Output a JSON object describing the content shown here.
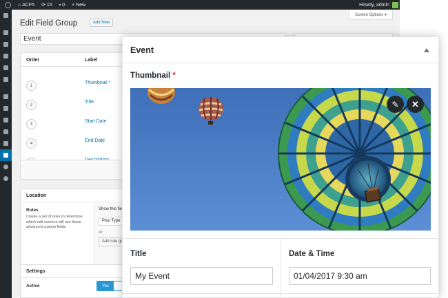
{
  "admin_bar": {
    "site_name": "ACF5",
    "updates_count": "15",
    "comments_count": "0",
    "new_label": "New",
    "greeting": "Howdy, admin"
  },
  "admin_menu": {
    "items": [
      "dashboard-icon",
      "pin-icon",
      "media-icon",
      "pages-icon",
      "comments-icon",
      "pin-icon",
      "appearance-icon",
      "plugins-icon",
      "users-icon",
      "tools-icon",
      "settings-icon",
      "custom-fields-icon",
      "gear-icon",
      "collapse-icon"
    ]
  },
  "edit_page": {
    "title": "Edit Field Group",
    "add_new_label": "Add New",
    "screen_options_label": "Screen Options ▾",
    "field_group_title": "Event"
  },
  "fields_table": {
    "headers": {
      "order": "Order",
      "label": "Label"
    },
    "rows": [
      {
        "order": "1",
        "label": "Thumbnail",
        "required": "*"
      },
      {
        "order": "2",
        "label": "Title"
      },
      {
        "order": "3",
        "label": "Start Date"
      },
      {
        "order": "4",
        "label": "End Date"
      },
      {
        "order": "5",
        "label": "Description"
      }
    ]
  },
  "location": {
    "heading": "Location",
    "rules_label": "Rules",
    "rules_description": "Create a set of rules to determine which edit screens will use these advanced custom fields",
    "show_label": "Show this field g",
    "post_type_value": "Post Type",
    "or_label": "or",
    "add_rule_group_label": "Add rule group"
  },
  "settings": {
    "heading": "Settings",
    "active_label": "Active",
    "toggle_value": "Yes"
  },
  "event_box": {
    "title": "Event",
    "thumbnail_label": "Thumbnail",
    "required_marker": "*",
    "edit_icon": "pencil-icon",
    "remove_icon": "close-icon",
    "edit_glyph": "✎",
    "remove_glyph": "✕",
    "title_field": {
      "label": "Title",
      "value": "My Event"
    },
    "datetime_field": {
      "label": "Date & Time",
      "value": "01/04/2017 9:30 am"
    }
  },
  "colors": {
    "admin_bar_bg": "#23282d",
    "accent_blue": "#0073aa",
    "required_red": "#dc3232",
    "toggle_blue": "#2a97d4",
    "sky_blue": "#4a7fc8"
  }
}
